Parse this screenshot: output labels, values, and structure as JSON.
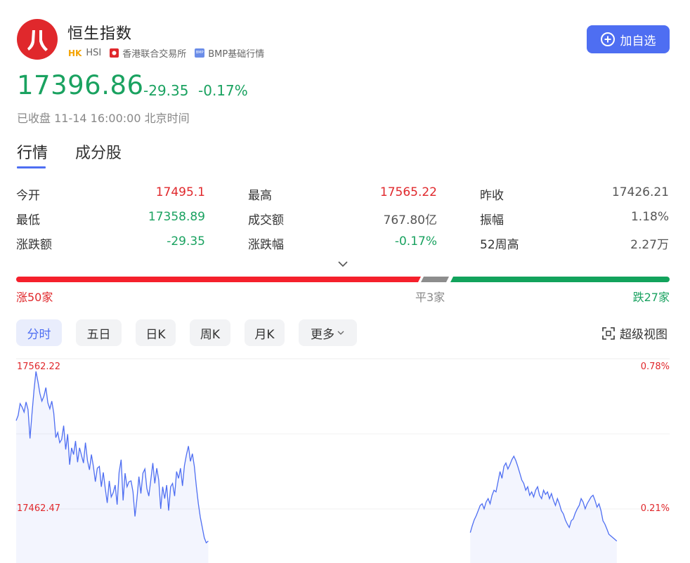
{
  "header": {
    "title": "恒生指数",
    "market_tag": "HK",
    "code": "HSI",
    "exchange": "香港联合交易所",
    "data_source": "BMP基础行情",
    "add_button_label": "加自选"
  },
  "quote": {
    "price": "17396.86",
    "change": "-29.35",
    "change_pct": "-0.17%",
    "status": "已收盘 11-14 16:00:00 北京时间"
  },
  "tabs": [
    {
      "label": "行情",
      "active": true
    },
    {
      "label": "成分股",
      "active": false
    }
  ],
  "stats": [
    [
      {
        "label": "今开",
        "value": "17495.1"
      },
      {
        "label": "最高",
        "value": "17565.22"
      },
      {
        "label": "昨收",
        "value": "17426.21"
      }
    ],
    [
      {
        "label": "最低",
        "value": "17358.89"
      },
      {
        "label": "成交额",
        "value": "767.80亿"
      },
      {
        "label": "振幅",
        "value": "1.18%"
      }
    ],
    [
      {
        "label": "涨跌额",
        "value": "-29.35"
      },
      {
        "label": "涨跌幅",
        "value": "-0.17%"
      },
      {
        "label": "52周高",
        "value": "2.27万"
      }
    ]
  ],
  "breadth": {
    "up": 50,
    "flat": 3,
    "down": 27,
    "up_label": "涨50家",
    "flat_label": "平3家",
    "down_label": "跌27家"
  },
  "period_buttons": [
    "分时",
    "五日",
    "日K",
    "周K",
    "月K",
    "更多"
  ],
  "super_view_label": "超级视图",
  "colors": {
    "up": "#e0282c",
    "down": "#1aa260",
    "accent": "#4e6ef2",
    "line": "#4e6ef2"
  },
  "chart_data": {
    "type": "area",
    "y_left_labels": [
      "17562.22",
      "17462.47"
    ],
    "y_right_labels": [
      "0.78%",
      "0.21%"
    ],
    "prev_close": 17426.21,
    "ylim": [
      17330,
      17575
    ],
    "x_count": 330,
    "segments": [
      {
        "x": [
          0,
          3,
          6,
          9,
          12,
          15,
          18,
          21,
          24,
          27,
          30,
          33,
          36,
          39,
          42,
          45,
          48,
          51,
          54,
          57,
          60,
          63,
          66,
          69,
          72,
          75,
          78,
          81,
          84,
          87,
          90,
          93,
          96,
          99,
          102,
          105,
          108,
          111,
          114,
          117,
          120,
          123,
          126,
          129,
          132,
          135,
          138,
          141,
          144,
          147,
          150,
          153,
          156,
          159,
          162,
          165,
          168,
          171,
          174,
          177,
          180,
          183,
          186,
          189,
          192,
          195,
          198,
          201,
          204,
          207,
          210,
          213,
          216,
          219,
          222,
          225,
          228,
          231,
          234,
          237,
          240,
          243,
          246,
          249,
          252,
          255,
          258,
          261,
          264,
          267,
          270,
          273,
          276,
          279,
          282,
          285,
          288,
          291
        ],
        "y": [
          17502,
          17508,
          17522,
          17518,
          17512,
          17524,
          17515,
          17481,
          17510,
          17538,
          17560,
          17548,
          17534,
          17525,
          17531,
          17541,
          17523,
          17516,
          17525,
          17511,
          17482,
          17488,
          17476,
          17480,
          17496,
          17468,
          17486,
          17450,
          17470,
          17462,
          17478,
          17453,
          17470,
          17461,
          17452,
          17476,
          17455,
          17444,
          17462,
          17448,
          17430,
          17446,
          17448,
          17424,
          17441,
          17422,
          17405,
          17431,
          17412,
          17417,
          17426,
          17403,
          17441,
          17456,
          17408,
          17440,
          17424,
          17430,
          17431,
          17418,
          17389,
          17410,
          17436,
          17416,
          17440,
          17445,
          17422,
          17413,
          17432,
          17452,
          17428,
          17446,
          17432,
          17398,
          17424,
          17410,
          17426,
          17396,
          17424,
          17428,
          17413,
          17442,
          17434,
          17446,
          17425,
          17449,
          17462,
          17472,
          17454,
          17463,
          17448,
          17424,
          17404,
          17388,
          17376,
          17364,
          17358,
          17360
        ]
      },
      {
        "x": [
          688,
          691,
          694,
          697,
          700,
          703,
          706,
          709,
          712,
          715,
          718,
          721,
          724,
          727,
          730,
          733,
          736,
          739,
          742,
          745,
          748,
          751,
          754,
          757,
          760,
          763,
          766,
          769,
          772,
          775,
          778,
          781,
          784,
          787,
          790,
          793,
          796,
          799,
          802,
          805,
          808,
          811,
          814,
          817,
          820,
          823,
          826,
          829,
          832,
          835,
          838,
          841,
          844,
          847,
          850,
          853,
          856,
          859,
          862,
          865,
          868,
          871,
          874,
          877,
          880,
          883,
          886,
          889,
          892,
          895,
          898,
          901,
          904,
          907,
          910
        ],
        "y": [
          17370,
          17378,
          17385,
          17390,
          17396,
          17402,
          17404,
          17398,
          17406,
          17410,
          17404,
          17414,
          17420,
          17418,
          17430,
          17442,
          17434,
          17448,
          17452,
          17445,
          17450,
          17456,
          17460,
          17455,
          17448,
          17440,
          17432,
          17428,
          17420,
          17424,
          17414,
          17418,
          17412,
          17420,
          17424,
          17414,
          17410,
          17420,
          17415,
          17418,
          17410,
          17416,
          17408,
          17402,
          17410,
          17404,
          17396,
          17392,
          17385,
          17380,
          17376,
          17384,
          17386,
          17393,
          17398,
          17402,
          17410,
          17406,
          17398,
          17404,
          17408,
          17412,
          17414,
          17408,
          17400,
          17404,
          17396,
          17384,
          17380,
          17374,
          17368,
          17366,
          17364,
          17362,
          17360
        ]
      }
    ]
  }
}
